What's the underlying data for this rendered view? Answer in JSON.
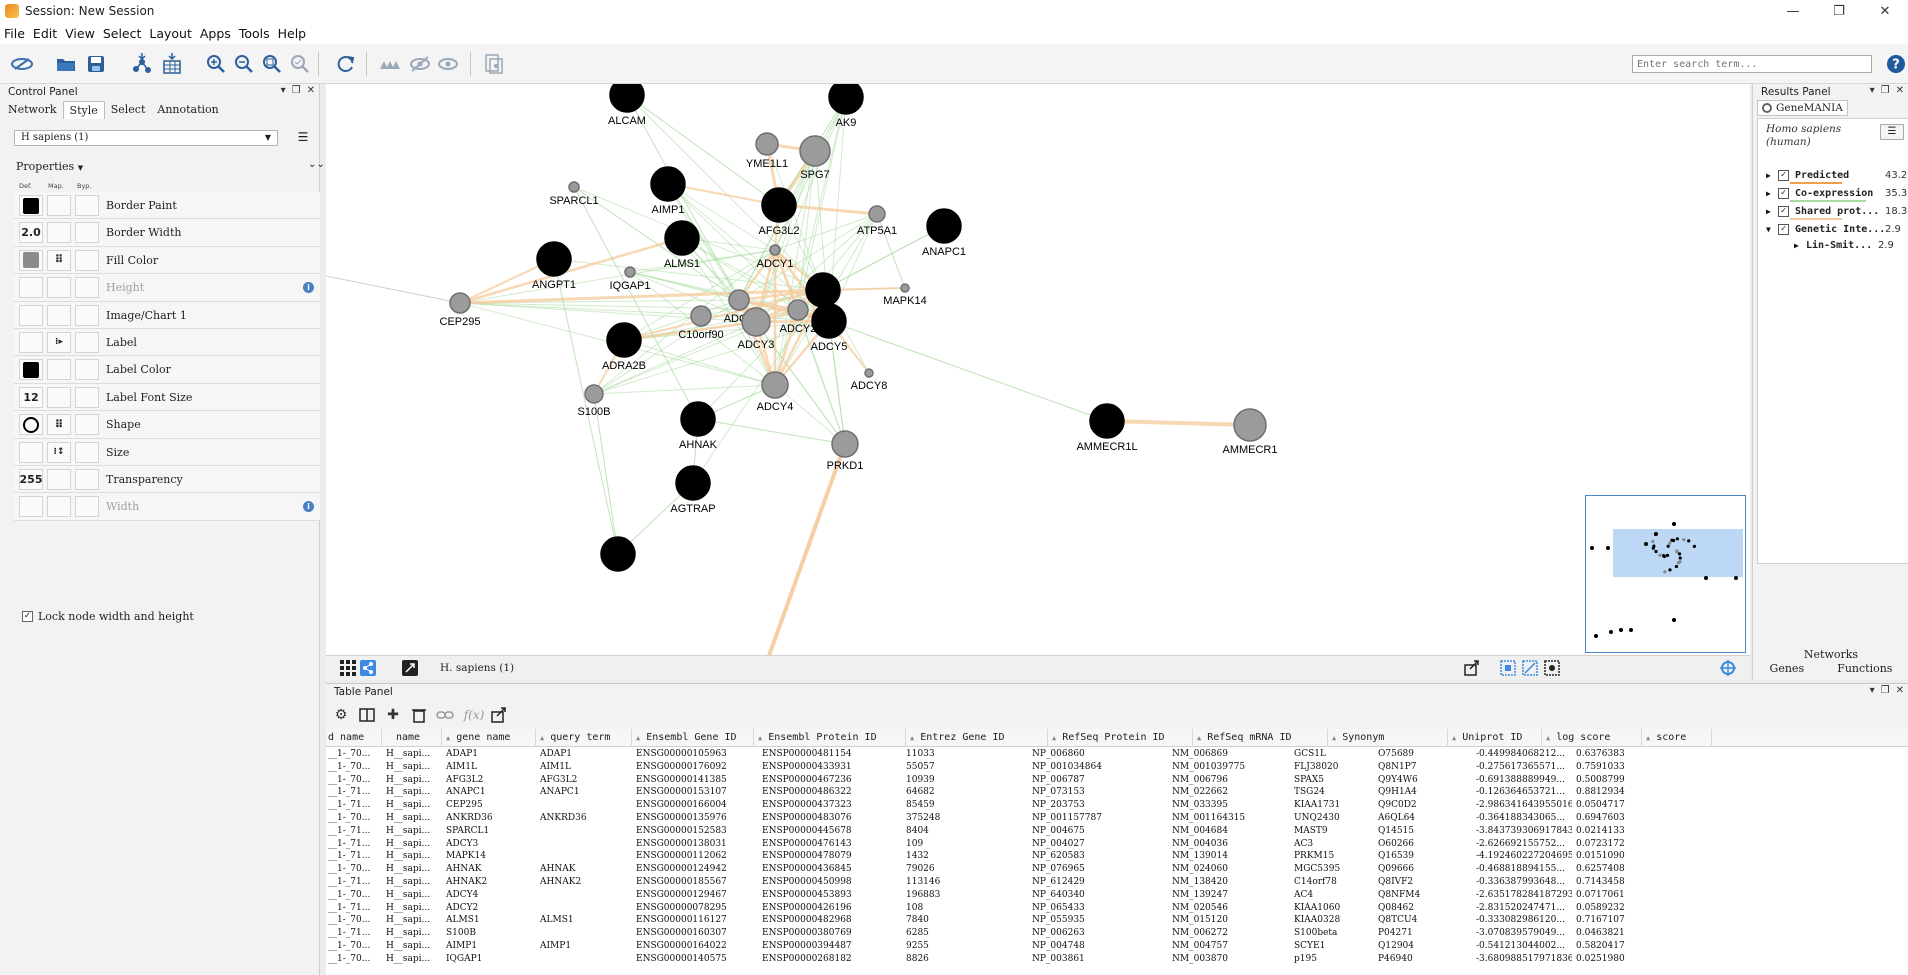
{
  "window": {
    "title": "Session: New Session",
    "min": "—",
    "restore": "❐",
    "close": "✕"
  },
  "menu": [
    "File",
    "Edit",
    "View",
    "Select",
    "Layout",
    "Apps",
    "Tools",
    "Help"
  ],
  "toolbar": {
    "search_placeholder": "Enter search term...",
    "help": "?"
  },
  "control_panel": {
    "title": "Control Panel",
    "tabs": [
      "Network",
      "Style",
      "Select",
      "Annotation"
    ],
    "active_tab": "Style",
    "style_selector": "H sapiens (1)",
    "properties_label": "Properties",
    "col_headers": [
      "Def.",
      "Map.",
      "Byp."
    ],
    "properties": [
      {
        "label": "Border Paint",
        "def": "black-swatch",
        "map": "",
        "disabled": false
      },
      {
        "label": "Border Width",
        "def": "2.0",
        "map": "",
        "disabled": false
      },
      {
        "label": "Fill Color",
        "def": "gray-swatch",
        "map": "mapping",
        "disabled": false
      },
      {
        "label": "Height",
        "def": "",
        "map": "",
        "disabled": true,
        "info": true
      },
      {
        "label": "Image/Chart 1",
        "def": "",
        "map": "",
        "disabled": false
      },
      {
        "label": "Label",
        "def": "",
        "map": "passthrough",
        "disabled": false
      },
      {
        "label": "Label Color",
        "def": "black-swatch",
        "map": "",
        "disabled": false
      },
      {
        "label": "Label Font Size",
        "def": "12",
        "map": "",
        "disabled": false
      },
      {
        "label": "Shape",
        "def": "circle-shape",
        "map": "mapping",
        "disabled": false
      },
      {
        "label": "Size",
        "def": "",
        "map": "continuous",
        "disabled": false
      },
      {
        "label": "Transparency",
        "def": "255",
        "map": "",
        "disabled": false
      },
      {
        "label": "Width",
        "def": "",
        "map": "",
        "disabled": true,
        "info": true
      }
    ],
    "lock_label": "Lock node width and height",
    "lock_checked": true
  },
  "network": {
    "name": "H. sapiens (1)",
    "colors": {
      "query_node": "#000000",
      "predicted_node": "#9b9b9b",
      "coexpression_edge": "#a9dba0",
      "shared_protein_edge": "#f5c99a"
    },
    "nodes": [
      {
        "id": "ALCAM",
        "label": "ALCAM",
        "type": "query"
      },
      {
        "id": "AK9",
        "label": "AK9",
        "type": "query"
      },
      {
        "id": "YME1L1",
        "label": "YME1L1",
        "type": "predicted"
      },
      {
        "id": "SPG7",
        "label": "SPG7",
        "type": "predicted"
      },
      {
        "id": "SPARCL1",
        "label": "SPARCL1",
        "type": "predicted"
      },
      {
        "id": "AIMP1",
        "label": "AIMP1",
        "type": "query"
      },
      {
        "id": "AFG3L2",
        "label": "AFG3L2",
        "type": "query"
      },
      {
        "id": "ATP5A1",
        "label": "ATP5A1",
        "type": "predicted"
      },
      {
        "id": "ANAPC1",
        "label": "ANAPC1",
        "type": "query"
      },
      {
        "id": "ALMS1",
        "label": "ALMS1",
        "type": "query"
      },
      {
        "id": "ADCY1",
        "label": "ADCY1",
        "type": "predicted"
      },
      {
        "id": "ANGPT1",
        "label": "ANGPT1",
        "type": "query"
      },
      {
        "id": "IQGAP1",
        "label": "IQGAP1",
        "type": "predicted"
      },
      {
        "id": "MAPK14",
        "label": "MAPK14",
        "type": "predicted"
      },
      {
        "id": "CEP295",
        "label": "CEP295",
        "type": "predicted"
      },
      {
        "id": "C10orf90",
        "label": "C10orf90",
        "type": "predicted"
      },
      {
        "id": "ADCY9",
        "label": "ADCY",
        "type": "predicted"
      },
      {
        "id": "ADCY3",
        "label": "ADCY3",
        "type": "predicted"
      },
      {
        "id": "ADCY2",
        "label": "ADCY2",
        "type": "predicted"
      },
      {
        "id": "AHNAK2",
        "label": "AH",
        "type": "query"
      },
      {
        "id": "ADCY5",
        "label": "ADCY5",
        "type": "query"
      },
      {
        "id": "ADRA2B",
        "label": "ADRA2B",
        "type": "query"
      },
      {
        "id": "ADCY8",
        "label": "ADCY8",
        "type": "predicted"
      },
      {
        "id": "ADCY4",
        "label": "ADCY4",
        "type": "predicted"
      },
      {
        "id": "S100B",
        "label": "S100B",
        "type": "predicted"
      },
      {
        "id": "AHNAK",
        "label": "AHNAK",
        "type": "query"
      },
      {
        "id": "PRKD1",
        "label": "PRKD1",
        "type": "predicted"
      },
      {
        "id": "AMMECR1L",
        "label": "AMMECR1L",
        "type": "query"
      },
      {
        "id": "AMMECR1",
        "label": "AMMECR1",
        "type": "predicted"
      },
      {
        "id": "AGTRAP",
        "label": "AGTRAP",
        "type": "query"
      },
      {
        "id": "EXTRA",
        "label": "",
        "type": "query"
      }
    ]
  },
  "results_panel": {
    "title": "Results Panel",
    "tab": "GeneMANIA",
    "species": "Homo sapiens",
    "species_common": "(human)",
    "networks": [
      {
        "name": "Predicted",
        "value": "43.2",
        "expanded": false,
        "color": "#f0a050"
      },
      {
        "name": "Co-expression",
        "value": "35.3",
        "expanded": false,
        "color": "#a9dba0"
      },
      {
        "name": "Shared prot...",
        "value": "18.3",
        "expanded": false,
        "color": "#f5c99a"
      },
      {
        "name": "Genetic Inte...",
        "value": "2.9",
        "expanded": true,
        "color": "#b0e0a0"
      },
      {
        "name": "Lin-Smit...",
        "value": "2.9",
        "expanded": false,
        "child": true
      }
    ],
    "bottom_title": "Networks",
    "bottom_tabs": [
      "Genes",
      "Functions"
    ]
  },
  "table_panel": {
    "title": "Table Panel",
    "columns": [
      "d name",
      "name",
      "gene name",
      "query term",
      "Ensembl Gene ID",
      "Ensembl Protein ID",
      "Entrez Gene ID",
      "RefSeq Protein ID",
      "RefSeq mRNA ID",
      "Synonym",
      "Uniprot ID",
      "log score",
      "score"
    ],
    "rows": [
      [
        "__1-_70...",
        "H__sapi...",
        "ADAP1",
        "ADAP1",
        "ENSG00000105963",
        "ENSP00000481154",
        "11033",
        "NP_006860",
        "NM_006869",
        "GCS1L",
        "O75689",
        "-0.449984068212...",
        "0.6376383"
      ],
      [
        "__1-_70...",
        "H__sapi...",
        "AIM1L",
        "AIM1L",
        "ENSG00000176092",
        "ENSP00000433931",
        "55057",
        "NP_001034864",
        "NM_001039775",
        "FLJ38020",
        "Q8N1P7",
        "-0.275617365571...",
        "0.7591033"
      ],
      [
        "__1-_70...",
        "H__sapi...",
        "AFG3L2",
        "AFG3L2",
        "ENSG00000141385",
        "ENSP00000467236",
        "10939",
        "NP_006787",
        "NM_006796",
        "SPAX5",
        "Q9Y4W6",
        "-0.691388889949...",
        "0.5008799"
      ],
      [
        "__1-_71...",
        "H__sapi...",
        "ANAPC1",
        "ANAPC1",
        "ENSG00000153107",
        "ENSP00000486322",
        "64682",
        "NP_073153",
        "NM_022662",
        "TSG24",
        "Q9H1A4",
        "-0.126364653721...",
        "0.8812934"
      ],
      [
        "__1-_71...",
        "H__sapi...",
        "CEP295",
        "",
        "ENSG00000166004",
        "ENSP00000437323",
        "85459",
        "NP_203753",
        "NM_033395",
        "KIAA1731",
        "Q9C0D2",
        "-2.986341643955016",
        "0.0504717"
      ],
      [
        "__1-_70...",
        "H__sapi...",
        "ANKRD36",
        "ANKRD36",
        "ENSG00000135976",
        "ENSP00000483076",
        "375248",
        "NP_001157787",
        "NM_001164315",
        "UNQ2430",
        "A6QL64",
        "-0.364188343065...",
        "0.6947603"
      ],
      [
        "__1-_71...",
        "H__sapi...",
        "SPARCL1",
        "",
        "ENSG00000152583",
        "ENSP00000445678",
        "8404",
        "NP_004675",
        "NM_004684",
        "MAST9",
        "Q14515",
        "-3.843739306917843",
        "0.0214133"
      ],
      [
        "__1-_71...",
        "H__sapi...",
        "ADCY3",
        "",
        "ENSG00000138031",
        "ENSP00000476143",
        "109",
        "NP_004027",
        "NM_004036",
        "AC3",
        "O60266",
        "-2.626692155752...",
        "0.0723172"
      ],
      [
        "__1-_71...",
        "H__sapi...",
        "MAPK14",
        "",
        "ENSG00000112062",
        "ENSP00000478079",
        "1432",
        "NP_620583",
        "NM_139014",
        "PRKM15",
        "Q16539",
        "-4.192460227204695",
        "0.0151090"
      ],
      [
        "__1-_70...",
        "H__sapi...",
        "AHNAK",
        "AHNAK",
        "ENSG00000124942",
        "ENSP00000436845",
        "79026",
        "NP_076965",
        "NM_024060",
        "MGC5395",
        "Q09666",
        "-0.468818894155...",
        "0.6257408"
      ],
      [
        "__1-_71...",
        "H__sapi...",
        "AHNAK2",
        "AHNAK2",
        "ENSG00000185567",
        "ENSP00000450998",
        "113146",
        "NP_612429",
        "NM_138420",
        "C14orf78",
        "Q8IVF2",
        "-0.336387993648...",
        "0.7143458"
      ],
      [
        "__1-_70...",
        "H__sapi...",
        "ADCY4",
        "",
        "ENSG00000129467",
        "ENSP00000453893",
        "196883",
        "NP_640340",
        "NM_139247",
        "AC4",
        "Q8NFM4",
        "-2.635178284187293",
        "0.0717061"
      ],
      [
        "__1-_71...",
        "H__sapi...",
        "ADCY2",
        "",
        "ENSG00000078295",
        "ENSP00000426196",
        "108",
        "NP_065433",
        "NM_020546",
        "KIAA1060",
        "Q08462",
        "-2.831520247471...",
        "0.0589232"
      ],
      [
        "__1-_70...",
        "H__sapi...",
        "ALMS1",
        "ALMS1",
        "ENSG00000116127",
        "ENSP00000482968",
        "7840",
        "NP_055935",
        "NM_015120",
        "KIAA0328",
        "Q8TCU4",
        "-0.333082986120...",
        "0.7167107"
      ],
      [
        "__1-_71...",
        "H__sapi...",
        "S100B",
        "",
        "ENSG00000160307",
        "ENSP00000380769",
        "6285",
        "NP_006263",
        "NM_006272",
        "S100beta",
        "P04271",
        "-3.070839579049...",
        "0.0463821"
      ],
      [
        "__1-_70...",
        "H__sapi...",
        "AIMP1",
        "AIMP1",
        "ENSG00000164022",
        "ENSP00000394487",
        "9255",
        "NP_004748",
        "NM_004757",
        "SCYE1",
        "Q12904",
        "-0.541213044002...",
        "0.5820417"
      ],
      [
        "__1-_70...",
        "H__sapi...",
        "IQGAP1",
        "",
        "ENSG00000140575",
        "ENSP00000268182",
        "8826",
        "NP_003861",
        "NM_003870",
        "p195",
        "P46940",
        "-3.680988517971836",
        "0.0251980"
      ]
    ]
  }
}
